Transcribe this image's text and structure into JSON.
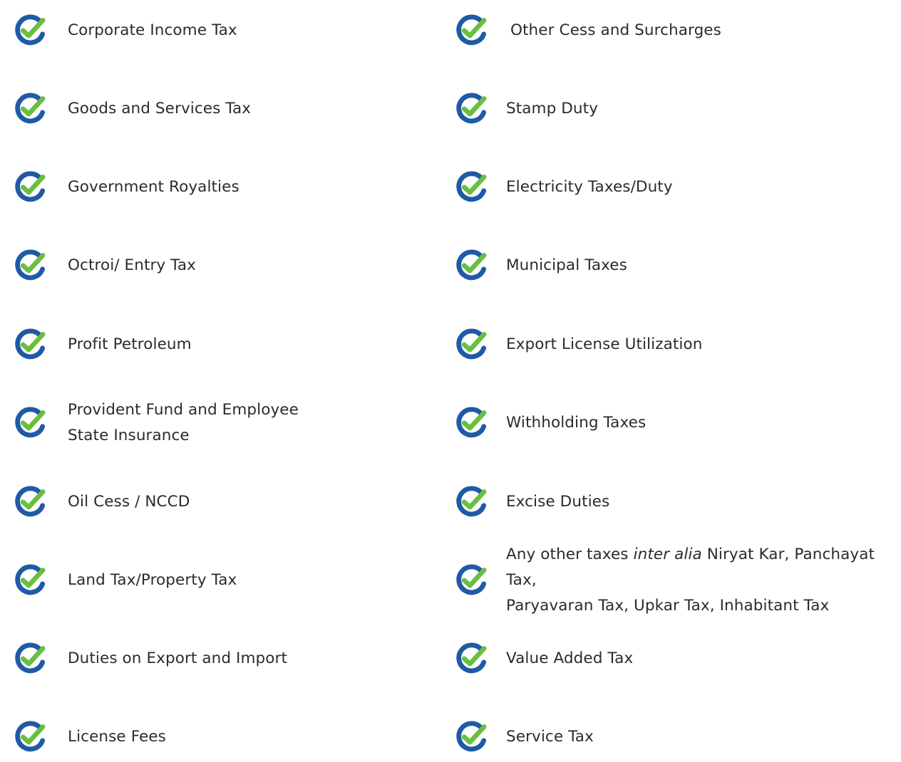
{
  "icon": "check-circle-icon",
  "colors": {
    "ring": "#1f5aa6",
    "check": "#69bf3f",
    "text": "#2b2b2b"
  },
  "left_items": [
    {
      "label": "Corporate Income Tax"
    },
    {
      "label": "Goods and Services Tax"
    },
    {
      "label": "Government Royalties"
    },
    {
      "label": "Octroi/ Entry Tax"
    },
    {
      "label": "Profit Petroleum"
    },
    {
      "line1": "Provident Fund and Employee",
      "line2": "State Insurance"
    },
    {
      "label": "Oil Cess / NCCD"
    },
    {
      "label": "Land Tax/Property Tax"
    },
    {
      "label": "Duties on Export and Import"
    },
    {
      "label": "License Fees"
    }
  ],
  "right_items": [
    {
      "label": "Other Cess and Surcharges"
    },
    {
      "label": "Stamp Duty"
    },
    {
      "label": "Electricity Taxes/Duty"
    },
    {
      "label": "Municipal Taxes"
    },
    {
      "label": "Export License Utilization"
    },
    {
      "label": "Withholding Taxes"
    },
    {
      "label": "Excise Duties"
    },
    {
      "prefix": "Any other taxes ",
      "emphasis": "inter alia",
      "suffix": " Niryat Kar, Panchayat Tax,",
      "line2": "Paryavaran Tax, Upkar Tax, Inhabitant Tax"
    },
    {
      "label": "Value Added Tax"
    },
    {
      "label": "Service Tax"
    }
  ]
}
